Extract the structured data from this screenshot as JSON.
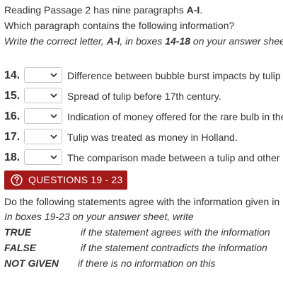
{
  "intro": {
    "line1_prefix": "Reading Passage 2 has nine paragraphs ",
    "line1_bold": "A-I",
    "line1_suffix": ".",
    "line2": "Which paragraph contains the following information?",
    "line3_prefix": "Write the correct letter, ",
    "line3_bold1": "A-I",
    "line3_mid": ", in boxes ",
    "line3_bold2": "14-18",
    "line3_suffix": " on your answer shee"
  },
  "questions": [
    {
      "number": "14.",
      "selected": "",
      "text": "Difference between bubble burst impacts by tulip"
    },
    {
      "number": "15.",
      "selected": "",
      "text": "Spread of tulip before 17th century."
    },
    {
      "number": "16.",
      "selected": "",
      "text": "Indication of money offered for the rare bulb in the"
    },
    {
      "number": "17.",
      "selected": "",
      "text": "Tulip was treated as money in Holland."
    },
    {
      "number": "18.",
      "selected": "",
      "text": "The comparison made between a tulip and other"
    }
  ],
  "banner": {
    "label": "QUESTIONS 19 - 23",
    "icon": "question-circle-icon",
    "color": "#a31a1a"
  },
  "section2": {
    "line1": "Do the following statements agree with the information given in",
    "line2": "In boxes 19-23 on your answer sheet, write",
    "definitions": [
      {
        "term": "TRUE",
        "text": "if the statement agrees with the information"
      },
      {
        "term": "FALSE",
        "text": "if the statement contradicts the information"
      },
      {
        "term": "NOT GIVEN",
        "text": "if there is no information on this"
      }
    ]
  }
}
